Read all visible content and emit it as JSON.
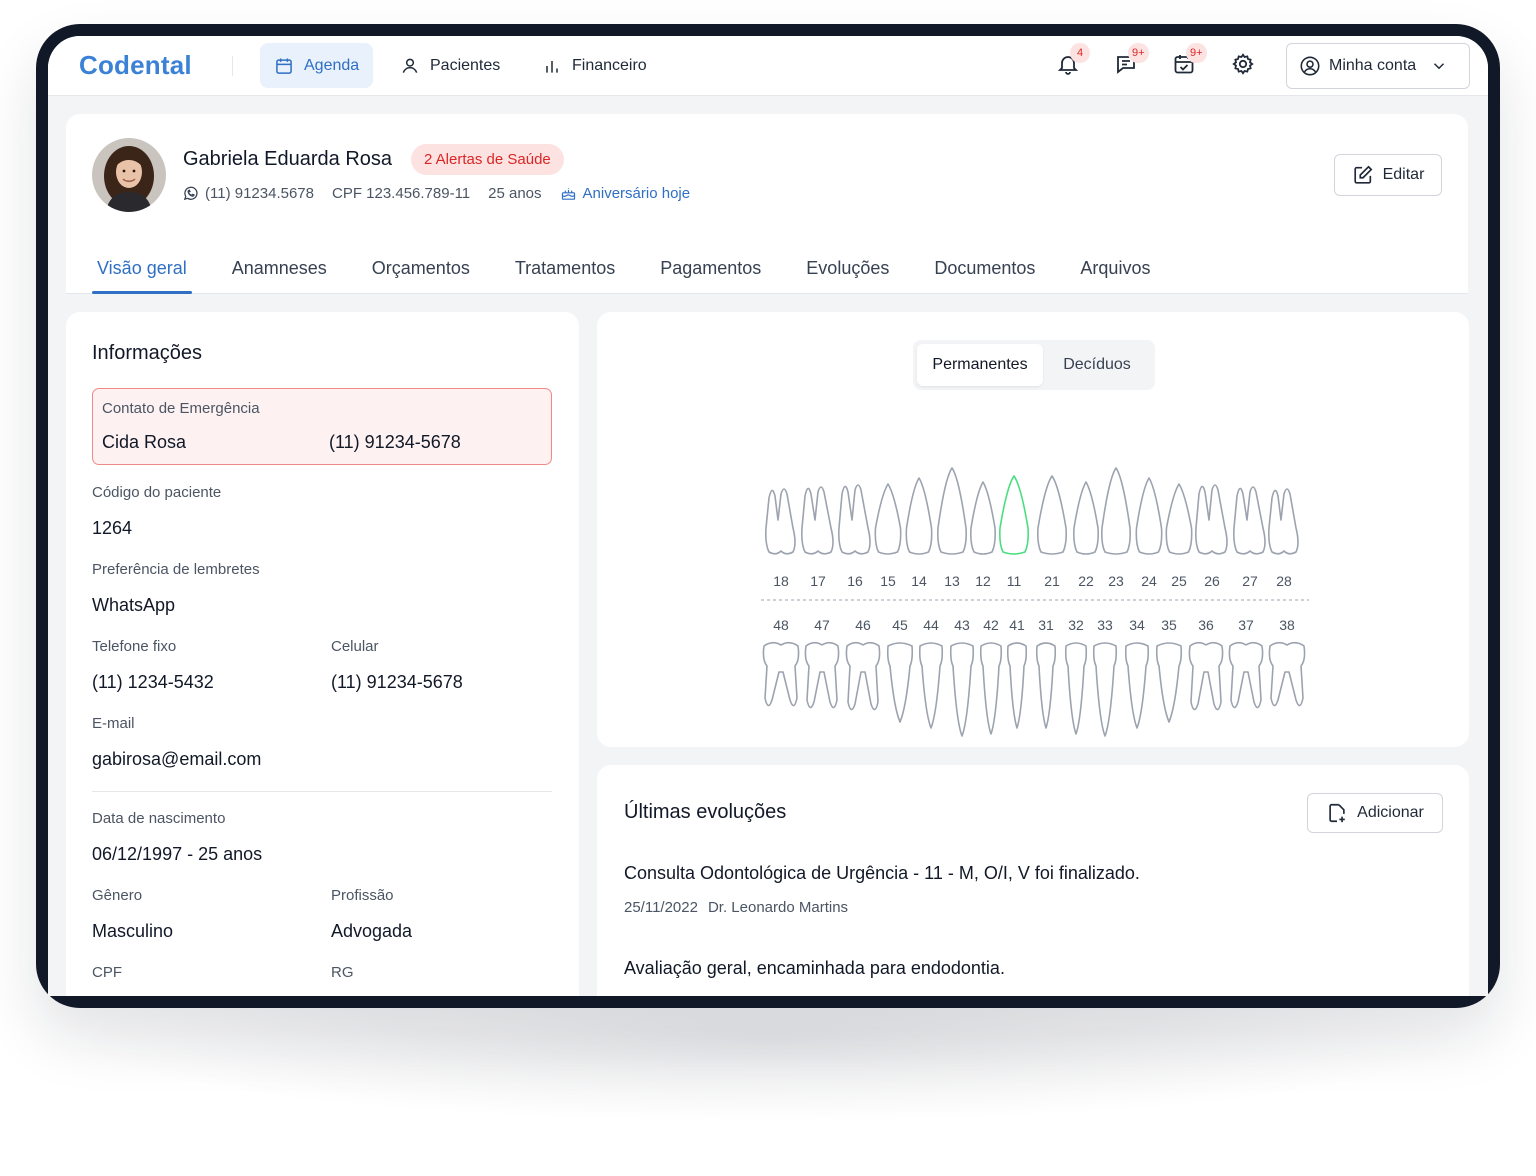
{
  "app": {
    "logo": "Codental"
  },
  "nav": {
    "items": [
      {
        "label": "Agenda",
        "icon": "calendar-icon",
        "active": true
      },
      {
        "label": "Pacientes",
        "icon": "user-icon",
        "active": false
      },
      {
        "label": "Financeiro",
        "icon": "bar-chart-icon",
        "active": false
      }
    ],
    "notifications_badge": "4",
    "messages_badge": "9+",
    "tasks_badge": "9+",
    "account_label": "Minha conta"
  },
  "patient": {
    "name": "Gabriela Eduarda Rosa",
    "alert_badge": "2 Alertas de Saúde",
    "phone": "(11) 91234.5678",
    "cpf": "CPF 123.456.789-11",
    "age": "25 anos",
    "birthday": "Aniversário hoje",
    "edit_label": "Editar"
  },
  "tabs": [
    "Visão geral",
    "Anamneses",
    "Orçamentos",
    "Tratamentos",
    "Pagamentos",
    "Evoluções",
    "Documentos",
    "Arquivos"
  ],
  "info": {
    "title": "Informações",
    "emergency": {
      "label": "Contato de Emergência",
      "name": "Cida Rosa",
      "phone": "(11) 91234-5678"
    },
    "code_label": "Código do paciente",
    "code_value": "1264",
    "reminder_label": "Preferência de lembretes",
    "reminder_value": "WhatsApp",
    "landline_label": "Telefone fixo",
    "landline_value": "(11) 1234-5432",
    "mobile_label": "Celular",
    "mobile_value": "(11) 91234-5678",
    "email_label": "E-mail",
    "email_value": "gabirosa@email.com",
    "birth_label": "Data de nascimento",
    "birth_value": "06/12/1997 - 25 anos",
    "gender_label": "Gênero",
    "gender_value": "Masculino",
    "profession_label": "Profissão",
    "profession_value": "Advogada",
    "cpf_label": "CPF",
    "rg_label": "RG"
  },
  "odontogram": {
    "toggle": [
      "Permanentes",
      "Decíduos"
    ],
    "upper_teeth": [
      "18",
      "17",
      "16",
      "15",
      "14",
      "13",
      "12",
      "11",
      "21",
      "22",
      "23",
      "24",
      "25",
      "26",
      "27",
      "28"
    ],
    "lower_teeth": [
      "48",
      "47",
      "46",
      "45",
      "44",
      "43",
      "42",
      "41",
      "31",
      "32",
      "33",
      "34",
      "35",
      "36",
      "37",
      "38"
    ],
    "highlighted_tooth": "11",
    "colors": {
      "outline": "#9ca3af",
      "highlight": "#4ade80"
    }
  },
  "evolutions": {
    "title": "Últimas evoluções",
    "add_label": "Adicionar",
    "items": [
      {
        "title": "Consulta Odontológica de Urgência - 11 - M, O/I, V foi finalizado.",
        "date": "25/11/2022",
        "doctor": "Dr. Leonardo Martins"
      },
      {
        "title": "Avaliação geral, encaminhada para endodontia."
      }
    ]
  }
}
